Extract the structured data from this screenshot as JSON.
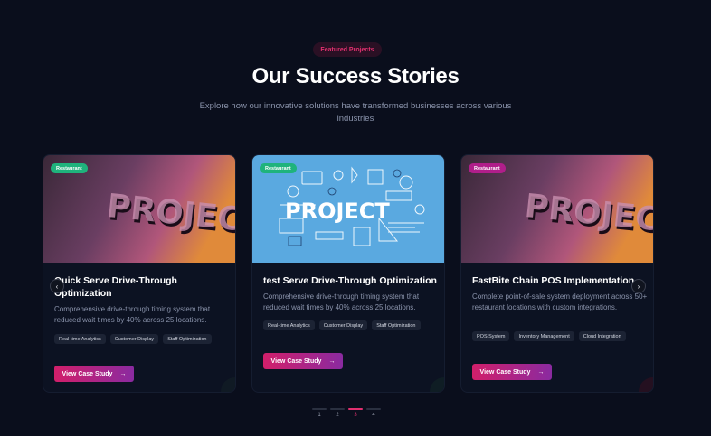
{
  "header": {
    "badge": "Featured Projects",
    "title": "Our Success Stories",
    "subtitle": "Explore how our innovative solutions have transformed businesses across various industries"
  },
  "cards": [
    {
      "tag": "Restaurant",
      "tag_color": "#1fb37c",
      "image_text": "PROJECTS",
      "title": "Quick Serve Drive-Through Optimization",
      "description": "Comprehensive drive-through timing system that reduced wait times by 40% across 25 locations.",
      "chips": [
        "Real-time Analytics",
        "Customer Display",
        "Staff Optimization"
      ],
      "button": "View Case Study"
    },
    {
      "tag": "Restaurant",
      "tag_color": "#1fb37c",
      "image_text": "PROJECT",
      "title": "test Serve Drive-Through Optimization",
      "description": "Comprehensive drive-through timing system that reduced wait times by 40% across 25 locations.",
      "chips": [
        "Real-time Analytics",
        "Customer Display",
        "Staff Optimization"
      ],
      "button": "View Case Study"
    },
    {
      "tag": "Restaurant",
      "tag_color": "#b01e8a",
      "image_text": "PROJECTS",
      "title": "FastBite Chain POS Implementation",
      "description": "Complete point-of-sale system deployment across 50+ restaurant locations with custom integrations.",
      "chips": [
        "POS System",
        "Inventory Management",
        "Cloud Integration"
      ],
      "button": "View Case Study"
    }
  ],
  "carousel": {
    "prev": "‹",
    "next": "›",
    "arrow": "→"
  },
  "pagination": {
    "pages": [
      "1",
      "2",
      "3",
      "4"
    ],
    "active_page": "3"
  },
  "colors": {
    "accent": "#e0306f",
    "background": "#0a0e1c",
    "card": "#0c1222",
    "image_blue": "#5aa9e0"
  }
}
